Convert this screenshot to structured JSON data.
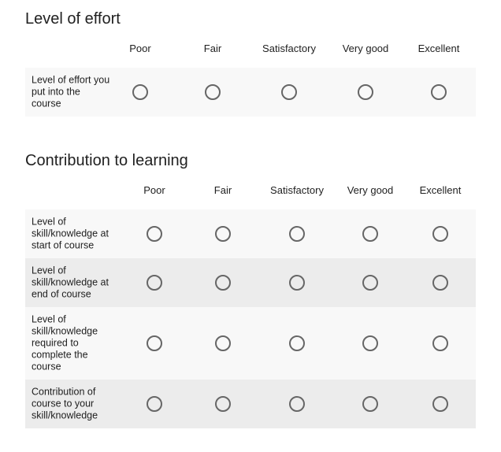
{
  "sections": [
    {
      "title": "Level of effort",
      "columns": [
        "Poor",
        "Fair",
        "Satisfactory",
        "Very good",
        "Excellent"
      ],
      "rows": [
        {
          "label": "Level of effort you put into the course"
        }
      ]
    },
    {
      "title": "Contribution to learning",
      "columns": [
        "Poor",
        "Fair",
        "Satisfactory",
        "Very good",
        "Excellent"
      ],
      "rows": [
        {
          "label": "Level of skill/knowledge at start of course"
        },
        {
          "label": "Level of skill/knowledge at end of course"
        },
        {
          "label": "Level of skill/knowledge required to complete the course"
        },
        {
          "label": "Contribution of course to your skill/knowledge"
        }
      ]
    }
  ]
}
